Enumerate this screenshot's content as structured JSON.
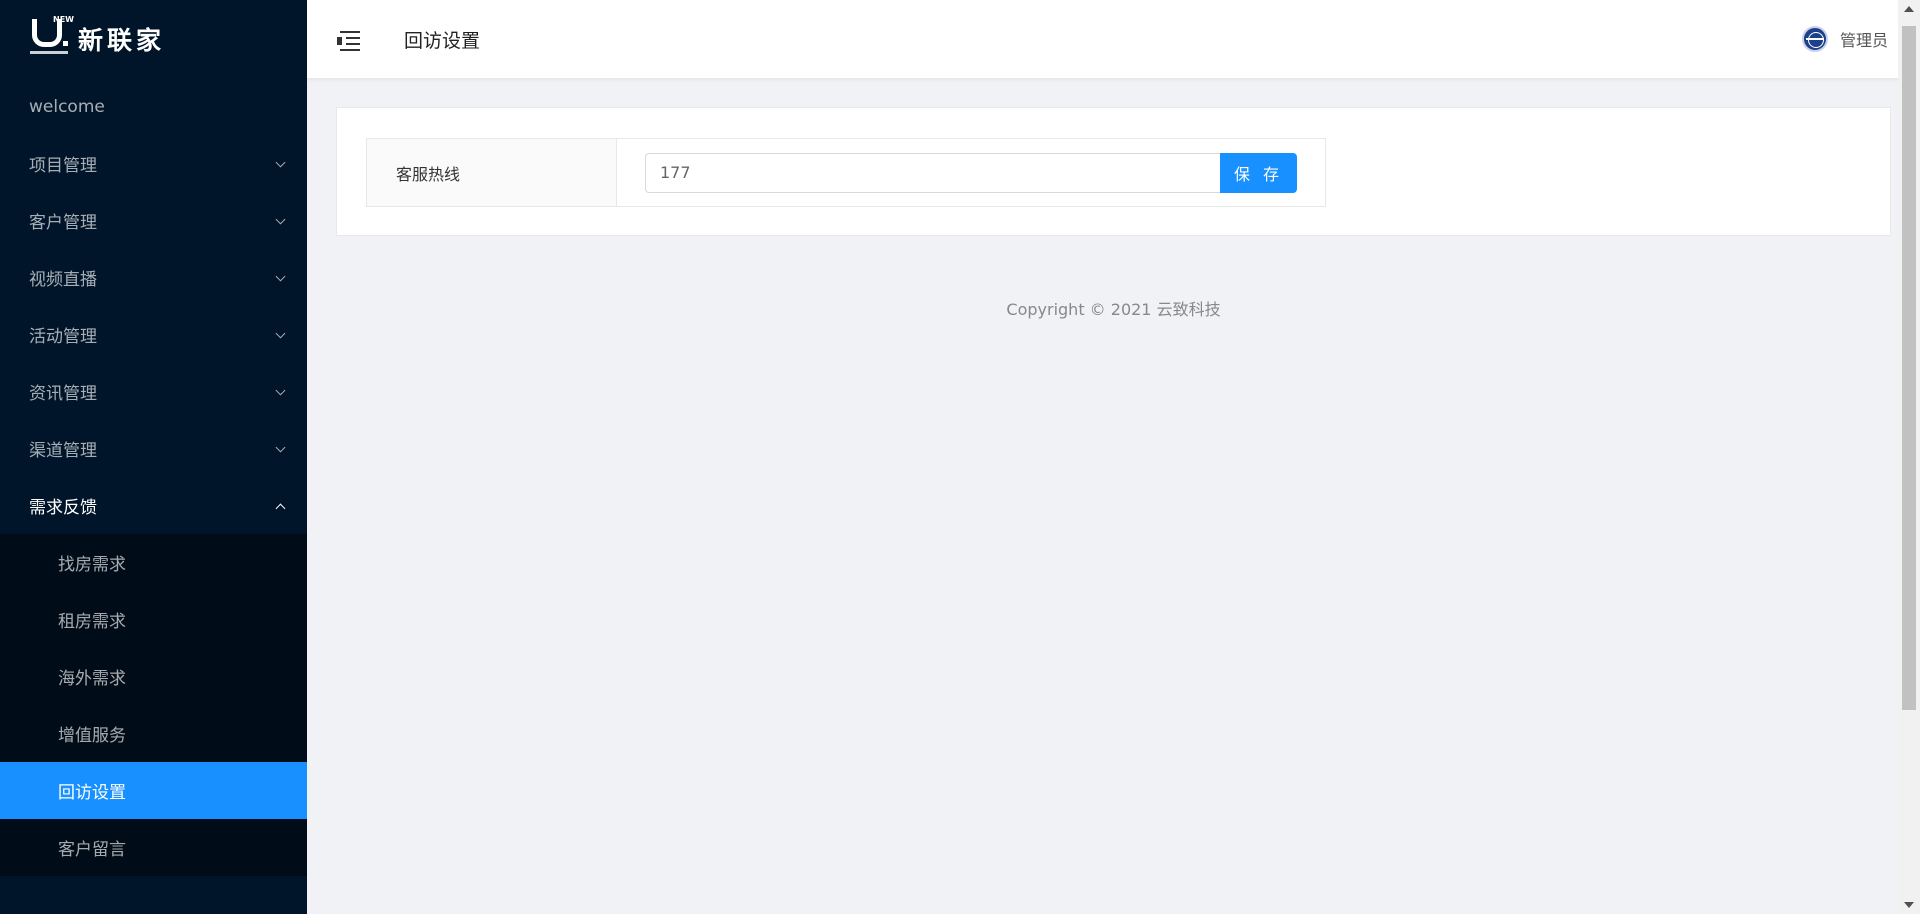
{
  "brand": {
    "name": "新联家",
    "mark_text": "NEW"
  },
  "sidebar": {
    "items": [
      {
        "label": "welcome",
        "expandable": false
      },
      {
        "label": "项目管理",
        "expandable": true
      },
      {
        "label": "客户管理",
        "expandable": true
      },
      {
        "label": "视频直播",
        "expandable": true
      },
      {
        "label": "活动管理",
        "expandable": true
      },
      {
        "label": "资讯管理",
        "expandable": true
      },
      {
        "label": "渠道管理",
        "expandable": true
      },
      {
        "label": "需求反馈",
        "expandable": true,
        "open": true
      }
    ],
    "submenu": [
      {
        "label": "找房需求"
      },
      {
        "label": "租房需求"
      },
      {
        "label": "海外需求"
      },
      {
        "label": "增值服务"
      },
      {
        "label": "回访设置",
        "active": true
      },
      {
        "label": "客户留言"
      }
    ]
  },
  "header": {
    "title": "回访设置",
    "user": "管理员"
  },
  "form": {
    "label": "客服热线",
    "value": "177",
    "save_label": "保 存"
  },
  "footer": {
    "copyright": "Copyright © 2021 云致科技"
  },
  "colors": {
    "sidebar": "#001529",
    "submenu": "#000c17",
    "accent": "#1890ff",
    "background": "#f0f2f5"
  }
}
